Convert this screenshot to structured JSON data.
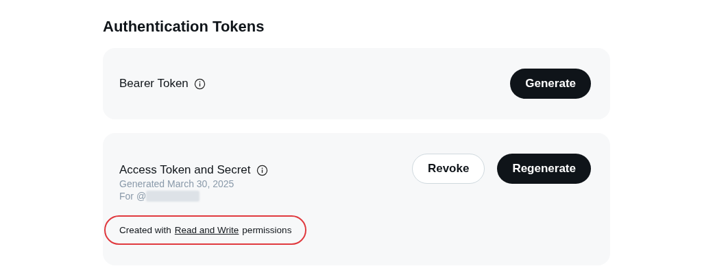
{
  "heading": "Authentication Tokens",
  "cards": [
    {
      "title": "Bearer Token",
      "info_icon": true,
      "buttons": [
        {
          "label": "Generate",
          "kind": "primary"
        }
      ]
    },
    {
      "title": "Access Token and Secret",
      "info_icon": true,
      "details": [
        {
          "text": "Generated March 30, 2025",
          "redacted": false
        },
        {
          "text": "For @",
          "redacted": true
        }
      ],
      "permissions": {
        "prefix": "Created with",
        "link": "Read and Write",
        "suffix": "permissions",
        "highlighted": true
      },
      "buttons": [
        {
          "label": "Revoke",
          "kind": "secondary"
        },
        {
          "label": "Regenerate",
          "kind": "primary"
        }
      ]
    }
  ]
}
